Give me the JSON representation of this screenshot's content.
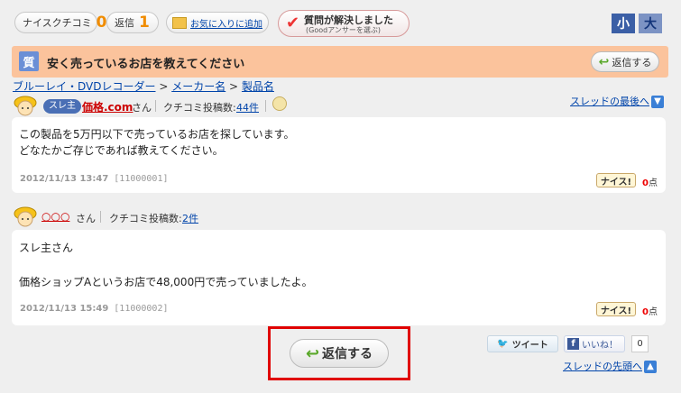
{
  "toolbar": {
    "nice_label": "ナイスクチコミ",
    "nice_count": "0",
    "reply_label": "返信",
    "reply_count": "1",
    "favorite_label": "お気に入りに追加",
    "resolved_title": "質問が解決しました",
    "resolved_sub": "(Goodアンサーを選ぶ)",
    "font_small": "小",
    "font_large": "大"
  },
  "question": {
    "icon_char": "質",
    "title": "安く売っているお店を教えてください",
    "reply_button": "返信する"
  },
  "breadcrumb": {
    "item1": "ブルーレイ・DVDレコーダー",
    "sep": ">",
    "item2": "メーカー名",
    "item3": "製品名"
  },
  "posts": [
    {
      "badge": "スレ主",
      "user": "価格.com",
      "san": "さん",
      "count_label": "クチコミ投稿数:",
      "count": "44件",
      "lines": [
        "この製品を5万円以下で売っているお店を探しています。",
        "どなたかご存じであれば教えてください。"
      ],
      "date": "2012/11/13 13:47",
      "post_id": "[11000001]",
      "nice": "ナイス!",
      "points": "0",
      "points_unit": "点"
    },
    {
      "user": "○○○",
      "san": "さん",
      "count_label": "クチコミ投稿数:",
      "count": "2件",
      "lines": [
        "スレ主さん",
        "",
        "価格ショップAというお店で48,000円で売っていましたよ。"
      ],
      "date": "2012/11/13 15:49",
      "post_id": "[11000002]",
      "nice": "ナイス!",
      "points": "0",
      "points_unit": "点"
    }
  ],
  "thread_end_link": "スレッドの最後へ",
  "thread_top_link": "スレッドの先頭へ",
  "reply_big": "返信する",
  "tweet": "ツイート",
  "like": "いいね！",
  "like_count": "0",
  "colors": {
    "highlight_box": "#e00000",
    "accent_orange": "#f08c00",
    "question_bar": "#fbc39c"
  }
}
